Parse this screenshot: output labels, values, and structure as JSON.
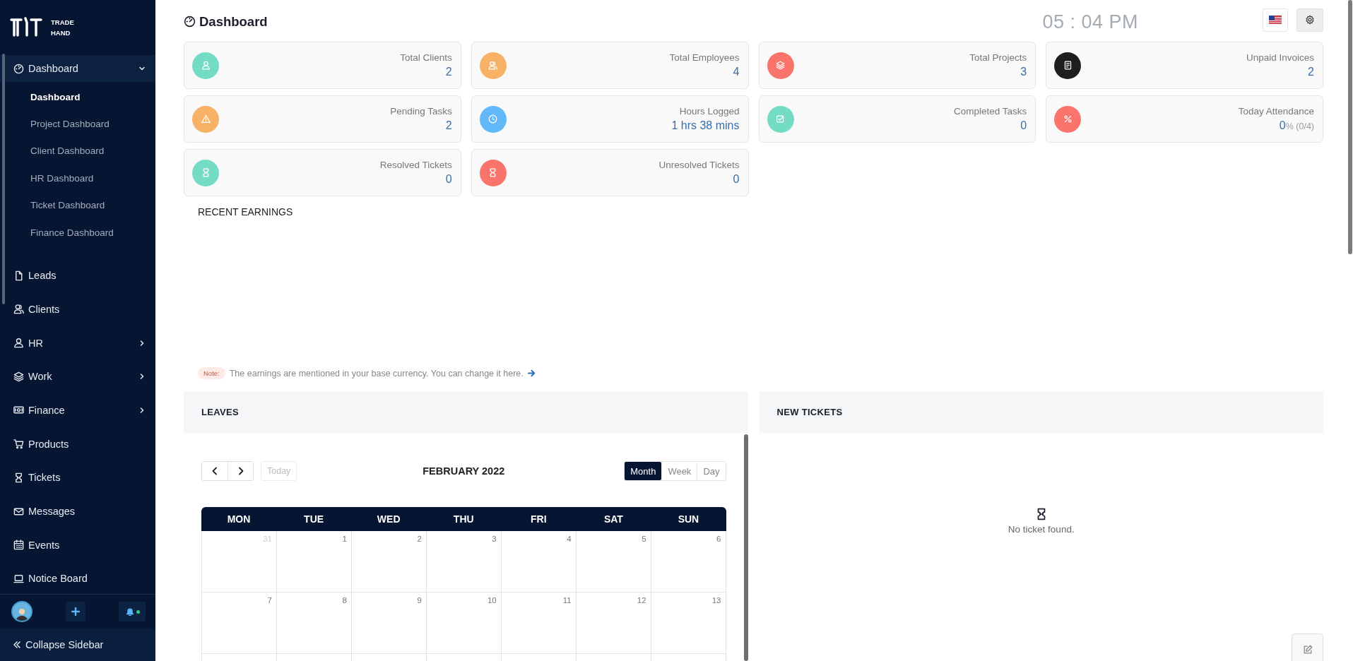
{
  "sidebar": {
    "logo": {
      "line_1": "TRADE",
      "line_2": "HAND"
    },
    "menu": [
      {
        "label": "Dashboard",
        "expanded": true,
        "children": [
          {
            "label": "Dashboard",
            "selected": true
          },
          {
            "label": "Project Dashboard",
            "selected": false
          },
          {
            "label": "Client Dashboard",
            "selected": false
          },
          {
            "label": "HR Dashboard",
            "selected": false
          },
          {
            "label": "Ticket Dashboard",
            "selected": false
          },
          {
            "label": "Finance Dashboard",
            "selected": false
          }
        ]
      },
      {
        "label": "Leads"
      },
      {
        "label": "Clients"
      },
      {
        "label": "HR",
        "expanded": false
      },
      {
        "label": "Work",
        "expanded": false
      },
      {
        "label": "Finance",
        "expanded": false
      },
      {
        "label": "Products"
      },
      {
        "label": "Tickets"
      },
      {
        "label": "Messages"
      },
      {
        "label": "Events"
      },
      {
        "label": "Notice Board"
      }
    ],
    "notifications_unread": true,
    "collapse_label": "Collapse Sidebar"
  },
  "header": {
    "title": "Dashboard",
    "clock": "05 : 04 PM"
  },
  "stats": [
    {
      "label": "Total Clients",
      "value": "2",
      "color": "#74dcc4"
    },
    {
      "label": "Total Employees",
      "value": "4",
      "color": "#f7b267"
    },
    {
      "label": "Total Projects",
      "value": "3",
      "color": "#f9756b"
    },
    {
      "label": "Unpaid Invoices",
      "value": "2",
      "color": "#1e1e1e"
    },
    {
      "label": "Pending Tasks",
      "value": "2",
      "color": "#f7b267"
    },
    {
      "label": "Hours Logged",
      "value": "1 hrs 38 mins",
      "color": "#62b9f9"
    },
    {
      "label": "Completed Tasks",
      "value": "0",
      "color": "#74dcc4"
    },
    {
      "label": "Today Attendance",
      "value": "0",
      "detail": "% (0/4)",
      "color": "#f9756b"
    },
    {
      "label": "Resolved Tickets",
      "value": "0",
      "color": "#74dcc4"
    },
    {
      "label": "Unresolved Tickets",
      "value": "0",
      "color": "#f9756b"
    }
  ],
  "recent_earnings": {
    "title": "RECENT EARNINGS",
    "note_badge": "Note:",
    "note": "The earnings are mentioned in your base currency. You can change it here."
  },
  "leaves": {
    "title": "LEAVES",
    "today_button": {
      "label": "Today",
      "disabled": true
    },
    "month_title": "FEBRUARY 2022",
    "views": [
      {
        "label": "Month",
        "selected": true
      },
      {
        "label": "Week",
        "selected": false
      },
      {
        "label": "Day",
        "selected": false
      }
    ],
    "weekdays": [
      "MON",
      "TUE",
      "WED",
      "THU",
      "FRI",
      "SAT",
      "SUN"
    ],
    "weeks": [
      [
        {
          "day": "31",
          "other_month": true
        },
        {
          "day": "1",
          "other_month": false
        },
        {
          "day": "2",
          "other_month": false
        },
        {
          "day": "3",
          "other_month": false
        },
        {
          "day": "4",
          "other_month": false
        },
        {
          "day": "5",
          "other_month": false
        },
        {
          "day": "6",
          "other_month": false
        }
      ],
      [
        {
          "day": "7",
          "other_month": false
        },
        {
          "day": "8",
          "other_month": false
        },
        {
          "day": "9",
          "other_month": false
        },
        {
          "day": "10",
          "other_month": false
        },
        {
          "day": "11",
          "other_month": false
        },
        {
          "day": "12",
          "other_month": false
        },
        {
          "day": "13",
          "other_month": false
        }
      ]
    ]
  },
  "new_tickets": {
    "title": "NEW TICKETS",
    "empty_message": "No ticket found."
  }
}
